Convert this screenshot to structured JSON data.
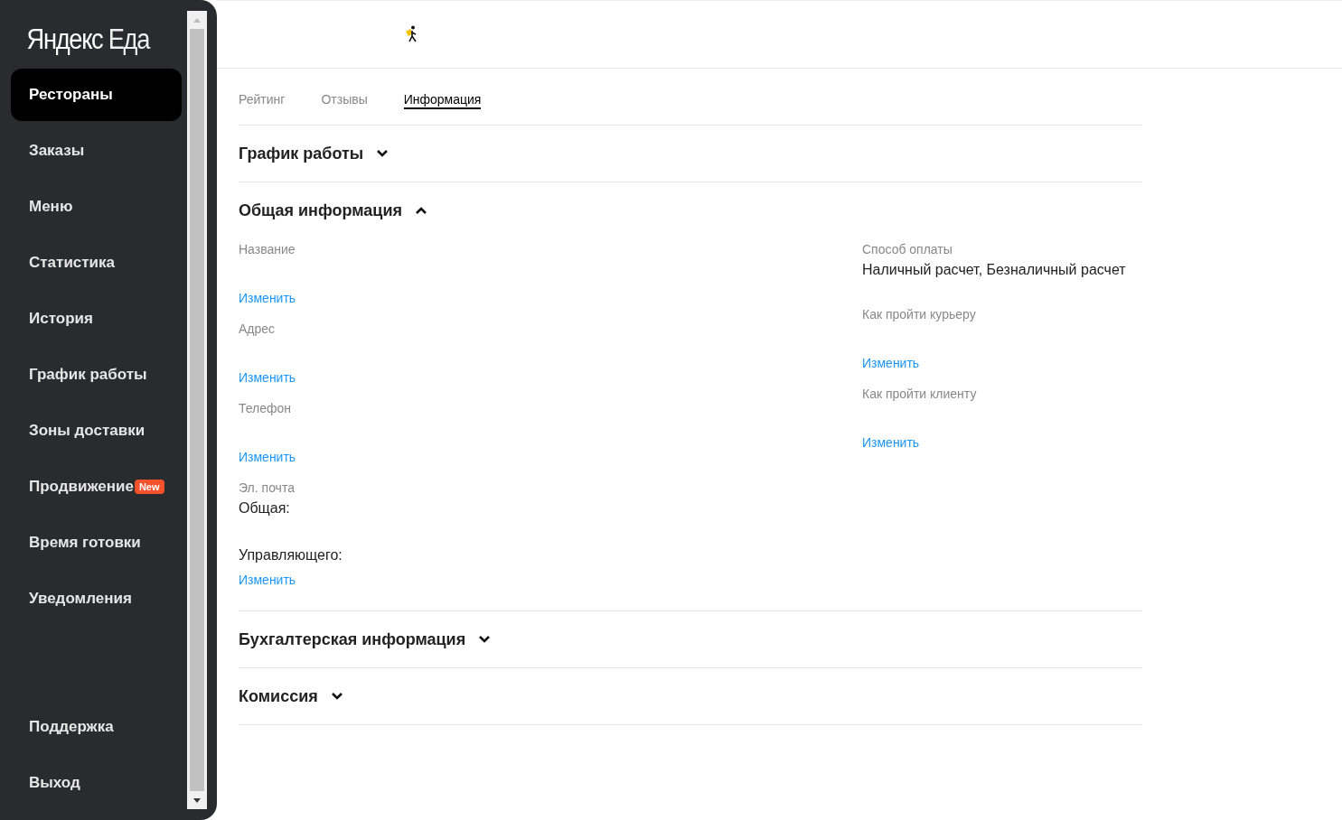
{
  "sidebar": {
    "logo": {
      "brand": "Яндекс",
      "product": "Еда"
    },
    "items": [
      {
        "label": "Рестораны",
        "selected": true
      },
      {
        "label": "Заказы",
        "selected": false
      },
      {
        "label": "Меню",
        "selected": false
      },
      {
        "label": "Статистика",
        "selected": false
      },
      {
        "label": "История",
        "selected": false
      },
      {
        "label": "График работы",
        "selected": false
      },
      {
        "label": "Зоны доставки",
        "selected": false
      },
      {
        "label": "Продвижение",
        "selected": false,
        "badge": "New"
      },
      {
        "label": "Время готовки",
        "selected": false
      },
      {
        "label": "Уведомления",
        "selected": false
      }
    ],
    "bottom_items": [
      {
        "label": "Поддержка",
        "selected": false
      },
      {
        "label": "Выход",
        "selected": false
      }
    ]
  },
  "tabs": [
    {
      "label": "Рейтинг",
      "selected": false
    },
    {
      "label": "Отзывы",
      "selected": false
    },
    {
      "label": "Информация",
      "selected": true
    }
  ],
  "sections": [
    {
      "title": "График работы",
      "expanded": false
    },
    {
      "title": "Общая информация",
      "expanded": true,
      "columns": [
        [
          {
            "label": "Название",
            "link": "Изменить"
          },
          {
            "label": "Адрес",
            "link": "Изменить"
          },
          {
            "label": "Телефон",
            "link": "Изменить"
          },
          {
            "label": "Эл. почта",
            "values": [
              "Общая:",
              "Управляющего:"
            ],
            "link": "Изменить"
          }
        ],
        [
          {
            "label": "Способ оплаты",
            "values": [
              "Наличный расчет, Безналичный расчет"
            ]
          },
          {
            "label": "Как пройти курьеру",
            "link": "Изменить"
          },
          {
            "label": "Как пройти клиенту",
            "link": "Изменить"
          }
        ]
      ]
    },
    {
      "title": "Бухгалтерская информация",
      "expanded": false
    },
    {
      "title": "Комиссия",
      "expanded": false
    }
  ]
}
